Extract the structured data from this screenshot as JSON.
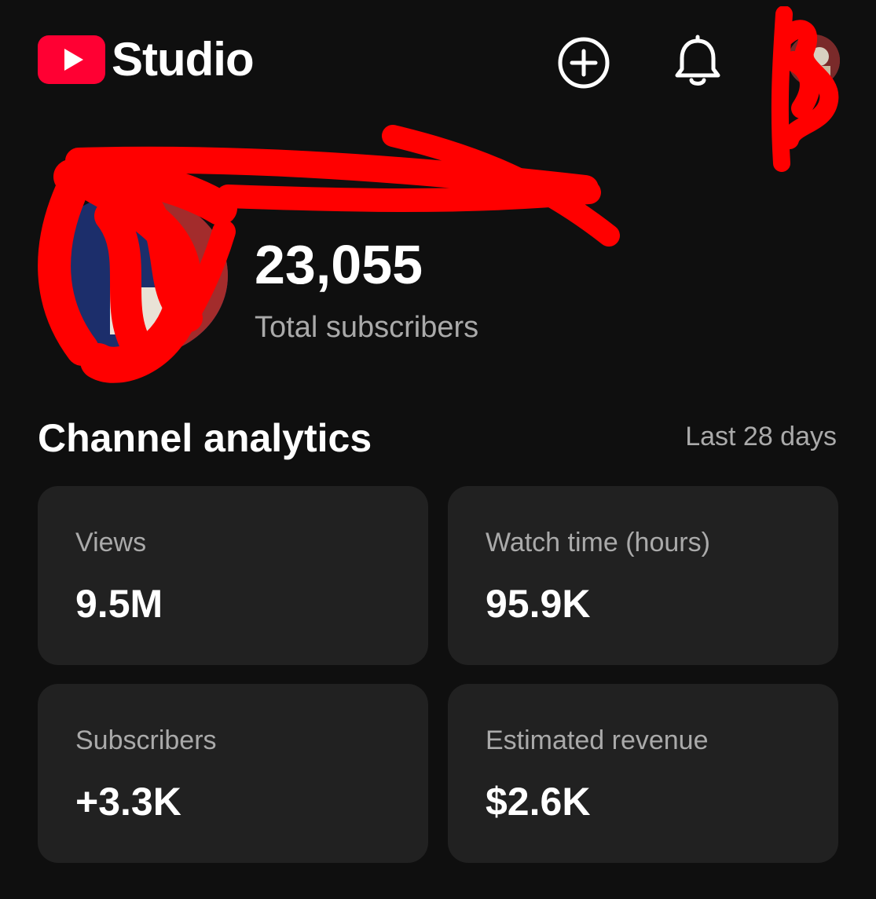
{
  "app": {
    "logo_text": "Studio",
    "brand_color": "#ff0033"
  },
  "header": {
    "icons": [
      "create-icon",
      "bell-icon",
      "account-avatar"
    ]
  },
  "channel": {
    "subscriber_count": "23,055",
    "subscriber_label": "Total subscribers"
  },
  "analytics": {
    "title": "Channel analytics",
    "period": "Last 28 days",
    "cards": [
      {
        "label": "Views",
        "value": "9.5M"
      },
      {
        "label": "Watch time (hours)",
        "value": "95.9K"
      },
      {
        "label": "Subscribers",
        "value": "+3.3K"
      },
      {
        "label": "Estimated revenue",
        "value": "$2.6K"
      }
    ]
  },
  "colors": {
    "background": "#0f0f0f",
    "card": "#212121",
    "text_primary": "#ffffff",
    "text_secondary": "#aaaaaa",
    "redaction": "#ff0000"
  }
}
